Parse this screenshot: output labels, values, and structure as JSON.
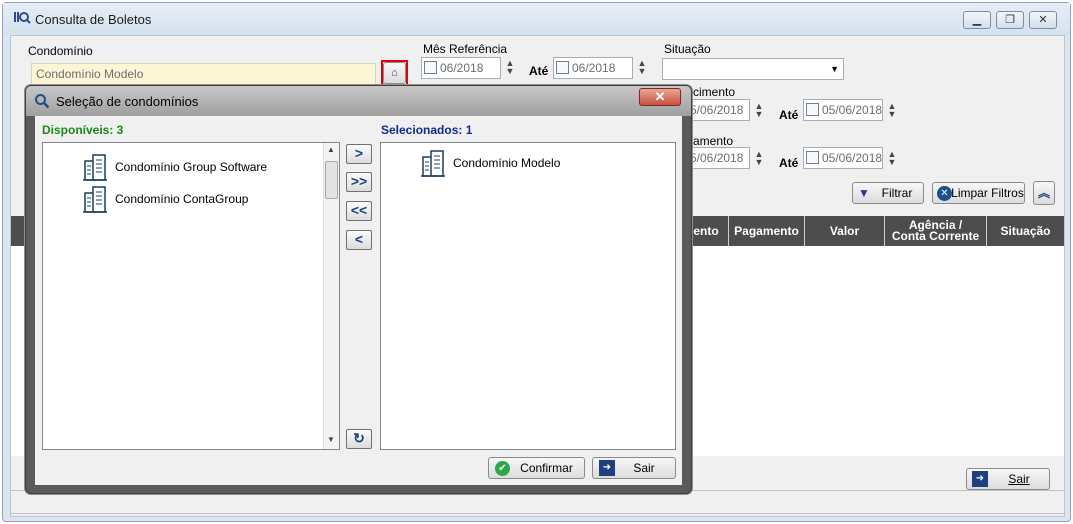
{
  "window": {
    "title": "Consulta de Boletos",
    "controls": [
      "minimize-icon",
      "restore-icon",
      "close-icon"
    ]
  },
  "filters": {
    "condominio_label": "Condomínio",
    "condominio_value": "Condomínio Modelo",
    "mes_referencia_label": "Mês Referência",
    "mes_ref_from": "06/2018",
    "ate_label": "Até",
    "mes_ref_to": "06/2018",
    "situacao_label": "Situação",
    "situacao_value": "",
    "vencimento_label": "cimento",
    "venc_from": "5/06/2018",
    "venc_to": "05/06/2018",
    "pagamento_label": "amento",
    "pag_from": "5/06/2018",
    "pag_to": "05/06/2018",
    "filtrar_label": "Filtrar",
    "limpar_label": "Limpar Filtros"
  },
  "grid": {
    "columns": [
      "nento",
      "Pagamento",
      "Valor",
      "Agência /\nConta Corrente",
      "Situação"
    ]
  },
  "footer": {
    "sair_label": "Sair"
  },
  "modal": {
    "title": "Seleção de condomínios",
    "available_label": "Disponíveis: 3",
    "selected_label": "Selecionados: 1",
    "available_items": [
      "Condomínio Group Software",
      "Condomínio ContaGroup"
    ],
    "selected_items": [
      "Condomínio Modelo"
    ],
    "move_buttons": [
      ">",
      ">>",
      "<<",
      "<"
    ],
    "confirm_label": "Confirmar",
    "exit_label": "Sair"
  },
  "colors": {
    "available_label": "#1a8a1a",
    "selected_label": "#102a8c",
    "highlight": "#e0000a"
  }
}
